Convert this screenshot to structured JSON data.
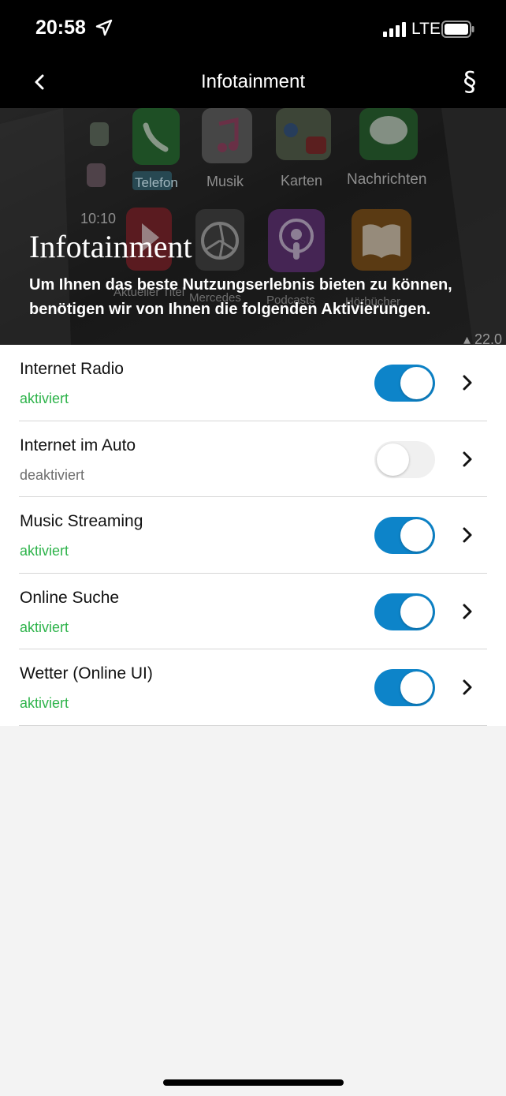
{
  "status_bar": {
    "time": "20:58",
    "network": "LTE",
    "icons": [
      "location-arrow-icon",
      "signal-bars-icon",
      "battery-icon"
    ]
  },
  "nav": {
    "title": "Infotainment",
    "back_icon": "chevron-left-icon",
    "legal_symbol": "§"
  },
  "hero": {
    "title": "Infotainment",
    "description": "Um Ihnen das beste Nutzungserlebnis bieten zu können, benötigen wir von Ihnen die folgenden Aktivierungen.",
    "background_labels": [
      "Telefon",
      "Musik",
      "Karten",
      "Nachrichten",
      "10:10",
      "Aktueller Titel",
      "Mercedes",
      "Podcasts",
      "Hörbücher",
      "22.0"
    ]
  },
  "settings": [
    {
      "title": "Internet Radio",
      "status": "aktiviert",
      "enabled": true
    },
    {
      "title": "Internet im Auto",
      "status": "deaktiviert",
      "enabled": false
    },
    {
      "title": "Music Streaming",
      "status": "aktiviert",
      "enabled": true
    },
    {
      "title": "Online Suche",
      "status": "aktiviert",
      "enabled": true
    },
    {
      "title": "Wetter (Online UI)",
      "status": "aktiviert",
      "enabled": true
    }
  ],
  "colors": {
    "toggle_on": "#0d84c9",
    "toggle_off": "#f0f0f0",
    "status_on": "#2db34a",
    "status_off": "#6e6e6e",
    "background": "#f3f3f3"
  }
}
